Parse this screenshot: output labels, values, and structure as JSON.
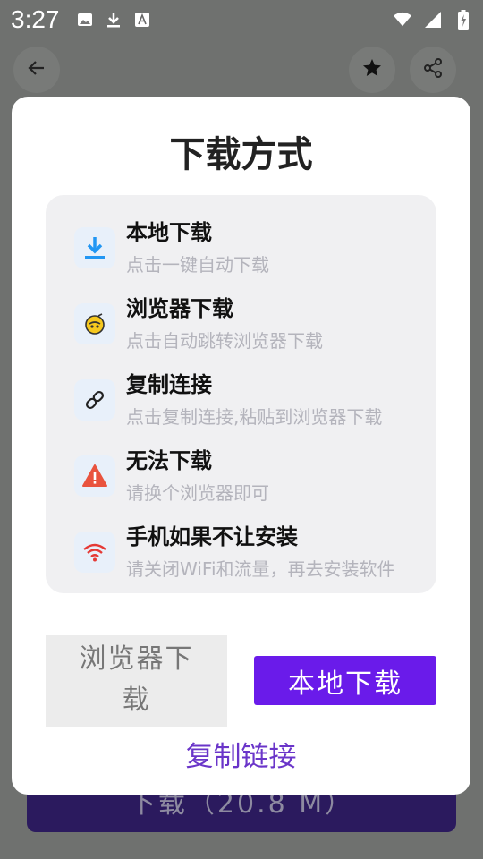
{
  "status_bar": {
    "time": "3:27",
    "left_icons": [
      "image-icon",
      "download-icon",
      "font-icon"
    ],
    "right_icons": [
      "wifi-icon",
      "signal-icon",
      "battery-charging-icon"
    ]
  },
  "background": {
    "back_icon": "arrow-left-icon",
    "star_icon": "star-icon",
    "share_icon": "share-icon",
    "download_button_label": "下载（20.8 M）"
  },
  "dialog": {
    "title": "下载方式",
    "options": [
      {
        "title": "本地下载",
        "subtitle": "点击一键自动下载",
        "icon": "download-arrow-icon",
        "icon_color": "#2196f3"
      },
      {
        "title": "浏览器下载",
        "subtitle": "点击自动跳转浏览器下载",
        "icon": "browser-logo-icon",
        "icon_color": "#f3c20c"
      },
      {
        "title": "复制连接",
        "subtitle": "点击复制连接,粘贴到浏览器下载",
        "icon": "link-icon",
        "icon_color": "#222222"
      },
      {
        "title": "无法下载",
        "subtitle": "请换个浏览器即可",
        "icon": "warning-icon",
        "icon_color": "#e9533e"
      },
      {
        "title": "手机如果不让安装",
        "subtitle": "请关闭WiFi和流量，再去安装软件",
        "icon": "wifi-icon",
        "icon_color": "#e53935"
      }
    ],
    "browser_button_label": "浏览器下载",
    "local_button_label": "本地下载",
    "copy_link_label": "复制链接",
    "accent_color": "#6a1bea"
  }
}
